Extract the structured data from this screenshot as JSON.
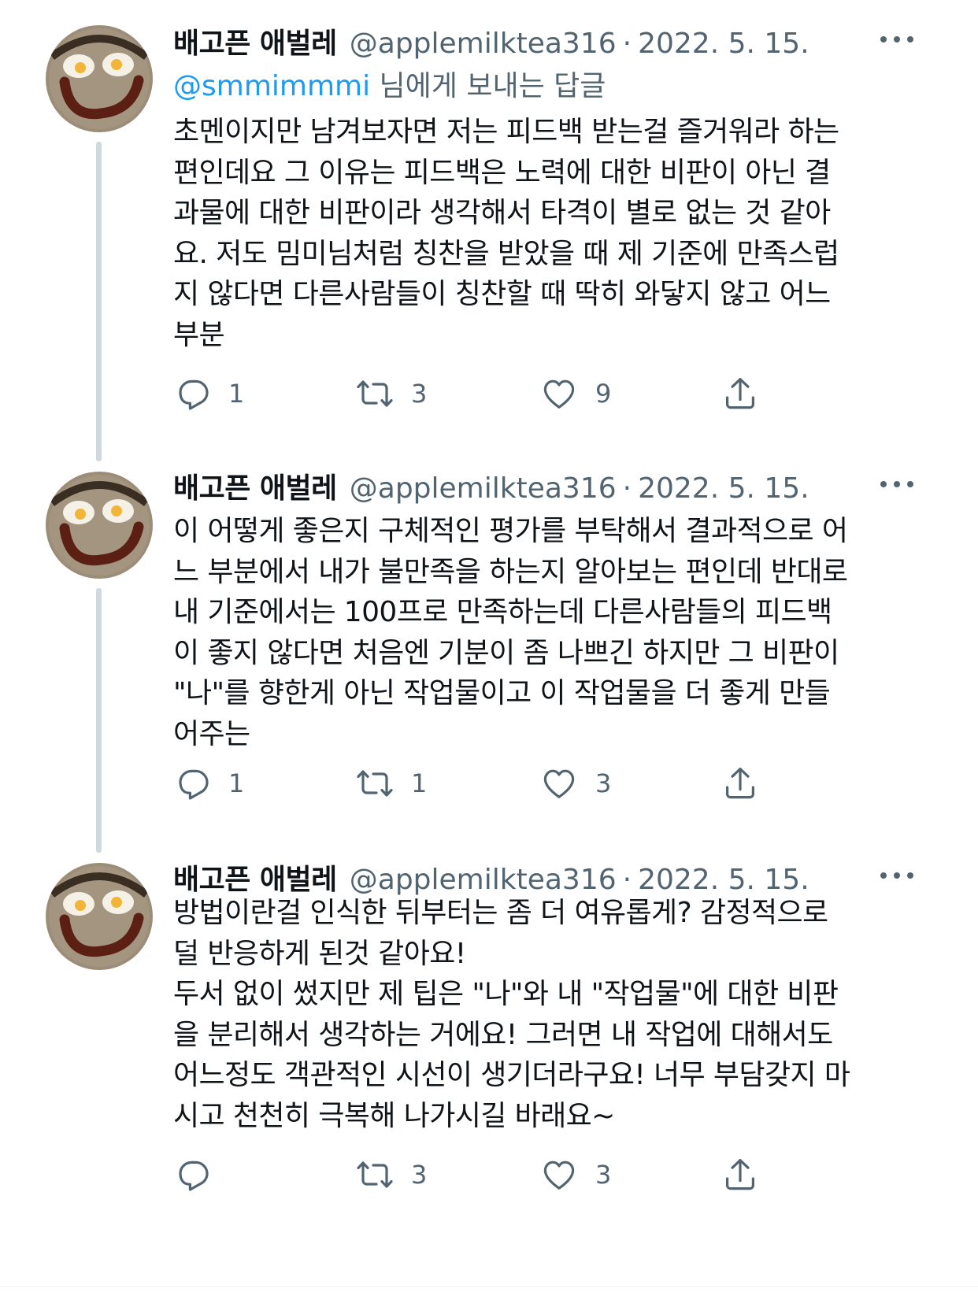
{
  "tweets": [
    {
      "display_name": "배고픈 애벌레",
      "handle": "@applemilktea316",
      "separator": "·",
      "date": "2022. 5. 15.",
      "reply_to": {
        "mention": "@smmimmmi",
        "suffix": " 님에게 보내는 답글"
      },
      "lines": [
        "초멘이지만 남겨보자면 저는 피드백 받는걸 즐거워라 하는",
        "편인데요 그 이유는 피드백은 노력에 대한 비판이 아닌 결",
        "과물에 대한 비판이라 생각해서 타격이 별로 없는 것 같아",
        "요. 저도 밈미님처럼 칭찬을 받았을 때 제 기준에 만족스럽",
        "지 않다면 다른사람들이 칭찬할 때 딱히 와닿지 않고 어느",
        "부분"
      ],
      "replies": "1",
      "retweets": "3",
      "likes": "9"
    },
    {
      "display_name": "배고픈 애벌레",
      "handle": "@applemilktea316",
      "separator": "·",
      "date": "2022. 5. 15.",
      "lines": [
        "이 어떻게 좋은지 구체적인 평가를 부탁해서 결과적으로 어",
        "느 부분에서 내가 불만족을 하는지 알아보는 편인데 반대로",
        "내 기준에서는 100프로 만족하는데 다른사람들의 피드백",
        "이 좋지 않다면 처음엔 기분이 좀 나쁘긴 하지만 그 비판이",
        "\"나\"를 향한게 아닌 작업물이고 이 작업물을 더 좋게 만들",
        "어주는"
      ],
      "replies": "1",
      "retweets": "1",
      "likes": "3"
    },
    {
      "display_name": "배고픈 애벌레",
      "handle": "@applemilktea316",
      "separator": "·",
      "date": "2022. 5. 15.",
      "lines": [
        "방법이란걸 인식한 뒤부터는 좀 더 여유롭게? 감정적으로",
        "덜 반응하게 된것 같아요!",
        "두서 없이 썼지만 제 팁은 \"나\"와 내 \"작업물\"에 대한 비판",
        "을 분리해서 생각하는 거에요! 그러면 내 작업에 대해서도",
        "어느정도 객관적인 시선이 생기더라구요! 너무 부담갖지 마",
        "시고 천천히 극복해 나가시길 바래요~"
      ],
      "replies": "",
      "retweets": "3",
      "likes": "3"
    }
  ],
  "icons": {
    "avatar": "smiley-egg-avatar",
    "reply": "reply-icon",
    "retweet": "retweet-icon",
    "like": "heart-icon",
    "share": "share-icon",
    "more": "more-icon"
  },
  "colors": {
    "text": "#0f1419",
    "secondary": "#536471",
    "link": "#1d9bf0",
    "thread_line": "#cfd9de"
  }
}
